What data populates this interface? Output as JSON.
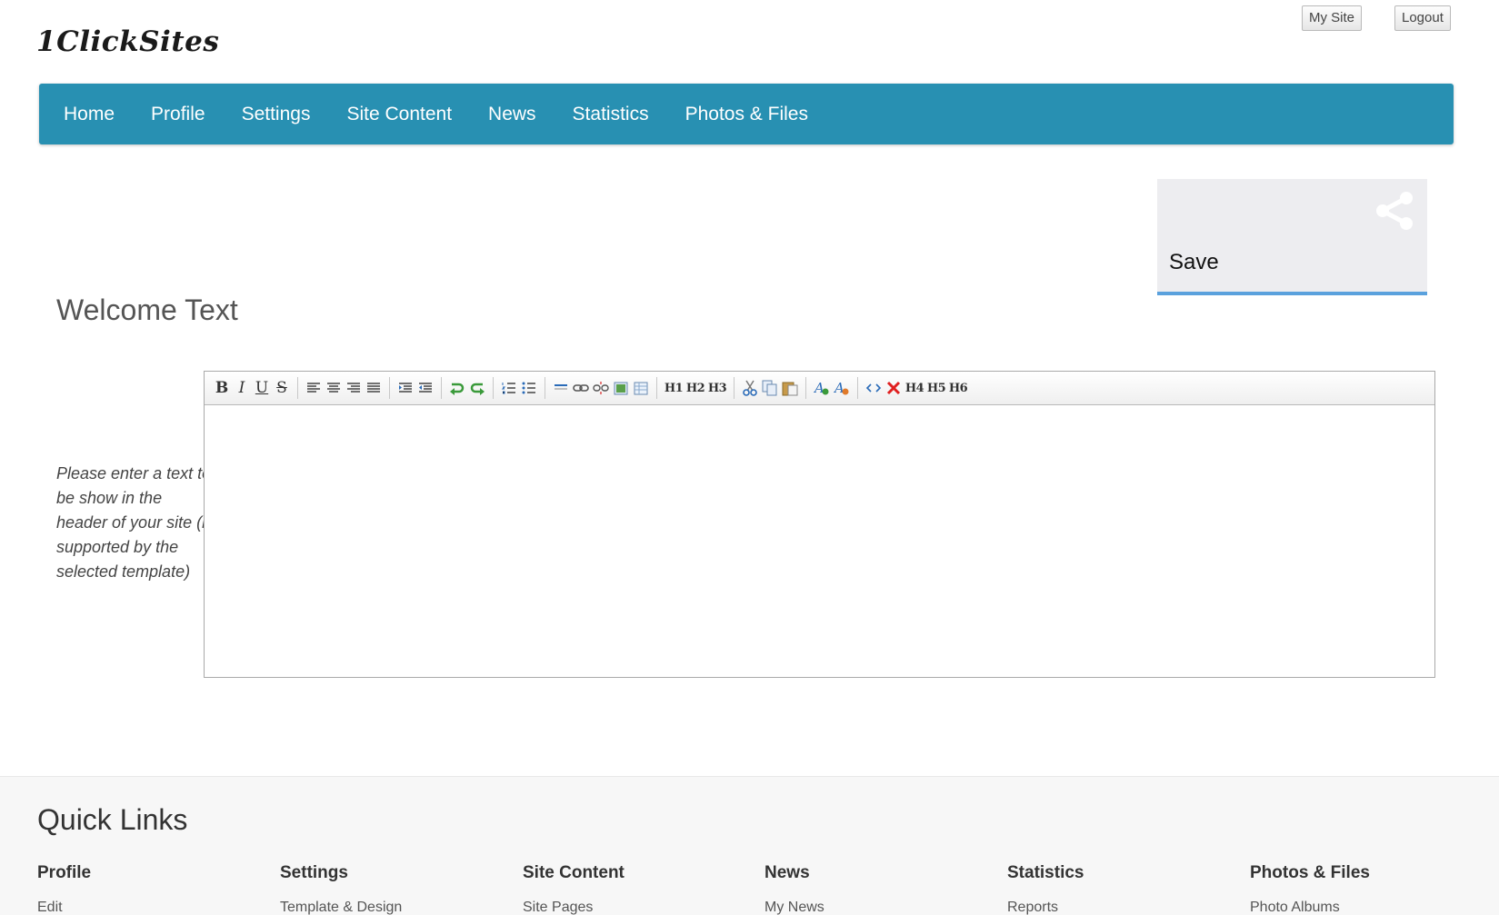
{
  "header": {
    "logo_text": "1ClickSites",
    "my_site_label": "My Site",
    "logout_label": "Logout"
  },
  "nav": {
    "items": [
      {
        "label": "Home"
      },
      {
        "label": "Profile"
      },
      {
        "label": "Settings"
      },
      {
        "label": "Site Content"
      },
      {
        "label": "News"
      },
      {
        "label": "Statistics"
      },
      {
        "label": "Photos & Files"
      }
    ]
  },
  "save_tile": {
    "label": "Save",
    "icon": "share-icon"
  },
  "content": {
    "section_title": "Welcome Text",
    "help_text": "Please enter a text to be show in the header of your site (if supported by the selected template)",
    "editor_value": ""
  },
  "toolbar": {
    "bold": "B",
    "italic": "I",
    "underline": "U",
    "strike": "S",
    "h1": "H1",
    "h2": "H2",
    "h3": "H3",
    "h4": "H4",
    "h5": "H5",
    "h6": "H6"
  },
  "footer": {
    "title": "Quick Links",
    "columns": [
      {
        "heading": "Profile",
        "link": "Edit"
      },
      {
        "heading": "Settings",
        "link": "Template & Design"
      },
      {
        "heading": "Site Content",
        "link": "Site Pages"
      },
      {
        "heading": "News",
        "link": "My News"
      },
      {
        "heading": "Statistics",
        "link": "Reports"
      },
      {
        "heading": "Photos & Files",
        "link": "Photo Albums"
      }
    ]
  },
  "colors": {
    "nav_background": "#2890b2",
    "save_underline": "#5aa1dd"
  }
}
